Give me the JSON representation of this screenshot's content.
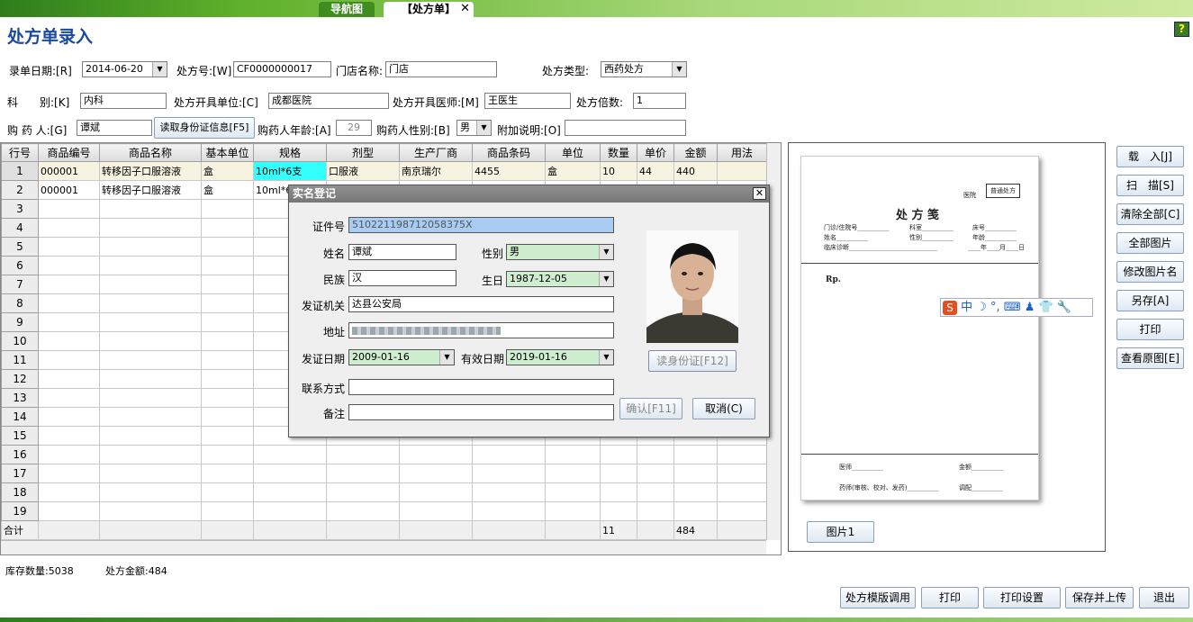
{
  "tabs": {
    "nav": "导航图",
    "rx": "【处方单】",
    "close": "✕"
  },
  "page_title": "处方单录入",
  "help_icon": "?",
  "form": {
    "date_label": "录单日期:[R]",
    "date_value": "2014-06-20",
    "rx_no_label": "处方号:[W]",
    "rx_no_value": "CF0000000017",
    "store_label": "门店名称:",
    "store_value": "门店",
    "rx_type_label": "处方类型:",
    "rx_type_value": "西药处方",
    "dept_label": "科　　别:[K]",
    "dept_value": "内科",
    "unit_label": "处方开具单位:[C]",
    "unit_value": "成都医院",
    "doctor_label": "处方开具医师:[M]",
    "doctor_value": "王医生",
    "multiple_label": "处方倍数:",
    "multiple_value": "1",
    "buyer_label": "购 药 人:[G]",
    "buyer_value": "谭斌",
    "read_id_btn": "读取身份证信息[F5]",
    "age_label": "购药人年龄:[A]",
    "age_value": "29",
    "gender_label": "购药人性别:[B]",
    "gender_value": "男",
    "note_label": "附加说明:[O]",
    "note_value": ""
  },
  "grid": {
    "columns": [
      "行号",
      "商品编号",
      "商品名称",
      "基本单位",
      "规格",
      "剂型",
      "生产厂商",
      "商品条码",
      "单位",
      "数量",
      "单价",
      "金额",
      "用法"
    ],
    "rows": [
      [
        "1",
        "000001",
        "转移因子口服溶液",
        "盒",
        "10ml*6支",
        "口服液",
        "南京瑞尔",
        "4455",
        "盒",
        "10",
        "44",
        "440",
        ""
      ],
      [
        "2",
        "000001",
        "转移因子口服溶液",
        "盒",
        "10ml*6",
        "",
        "",
        "",
        "",
        "",
        "",
        "",
        ""
      ],
      [
        "3"
      ],
      [
        "4"
      ],
      [
        "5"
      ],
      [
        "6"
      ],
      [
        "7"
      ],
      [
        "8"
      ],
      [
        "9"
      ],
      [
        "10"
      ],
      [
        "11"
      ],
      [
        "12"
      ],
      [
        "13"
      ],
      [
        "14"
      ],
      [
        "15"
      ],
      [
        "16"
      ],
      [
        "17"
      ],
      [
        "18"
      ],
      [
        "19"
      ]
    ],
    "total": {
      "label": "合计",
      "qty": "11",
      "amount": "484"
    }
  },
  "side_buttons": [
    "载　入[J]",
    "扫　描[S]",
    "清除全部[C]",
    "全部图片",
    "修改图片名",
    "另存[A]",
    "打印",
    "查看原图[E]"
  ],
  "preview": {
    "image_button": "图片1",
    "paper": {
      "type_box": "普通处方",
      "hospital": "医院",
      "heading": "处 方 笺",
      "l1a": "门诊/住院号__________",
      "l1b": "科室__________",
      "l1c": "床号__________",
      "l2a": "姓名__________",
      "l2b": "性别__________",
      "l2c": "年龄__________",
      "l3a": "临床诊断____________________________",
      "l3b": "____年____月____日",
      "rp": "Rp.",
      "f1a": "医师__________",
      "f1b": "金额__________",
      "f2a": "药师(审核、校对、发药)__________",
      "f2b": "调配__________"
    }
  },
  "ime": {
    "brand": "S",
    "text": "中 ☽ °, ⌨ ♟ 👕 🔧"
  },
  "dialog": {
    "title": "实名登记",
    "id_label": "证件号",
    "id_value": "510221198712058375X",
    "name_label": "姓名",
    "name_value": "谭斌",
    "sex_label": "性别",
    "sex_value": "男",
    "nation_label": "民族",
    "nation_value": "汉",
    "birth_label": "生日",
    "birth_value": "1987-12-05",
    "authority_label": "发证机关",
    "authority_value": "达县公安局",
    "address_label": "地址",
    "address_value": "",
    "issue_label": "发证日期",
    "issue_value": "2009-01-16",
    "expire_label": "有效日期",
    "expire_value": "2019-01-16",
    "contact_label": "联系方式",
    "contact_value": "",
    "remark_label": "备注",
    "remark_value": "",
    "read_btn": "读身份证[F12]",
    "confirm_btn": "确认[F11]",
    "cancel_btn": "取消(C)"
  },
  "status": {
    "stock": "库存数量:5038",
    "amount": "处方金额:484"
  },
  "bottom_buttons": [
    "处方模版调用",
    "打印",
    "打印设置",
    "保存并上传",
    "退出"
  ]
}
